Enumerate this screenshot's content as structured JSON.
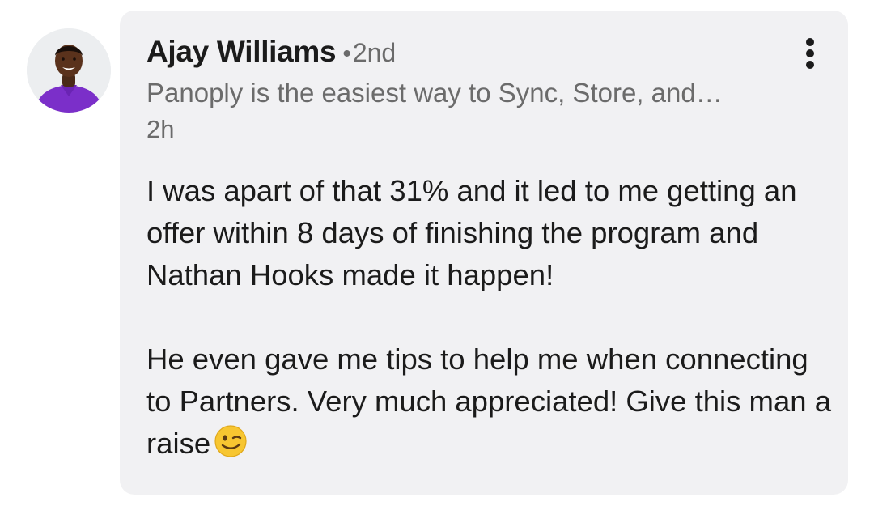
{
  "comment": {
    "author": {
      "name": "Ajay Williams",
      "degree_separator": "•",
      "connection_degree": "2nd",
      "headline": "Panoply is the easiest way to Sync, Store, and…",
      "avatar_icon": "profile-photo"
    },
    "timestamp": "2h",
    "more_icon": "vertical-ellipsis-icon",
    "paragraphs": [
      "I was apart of that 31% and it led to me getting an offer within 8 days of finishing the program and Nathan Hooks made it happen!",
      "He even gave me tips to help me when connecting to Partners. Very much appreciated! Give this man a raise"
    ],
    "emoji": "winking-face-icon"
  },
  "colors": {
    "bubble_background": "#f1f1f3",
    "primary_text": "#1b1b1b",
    "secondary_text": "#6b6b6b",
    "avatar_shirt": "#7b2fc9"
  }
}
